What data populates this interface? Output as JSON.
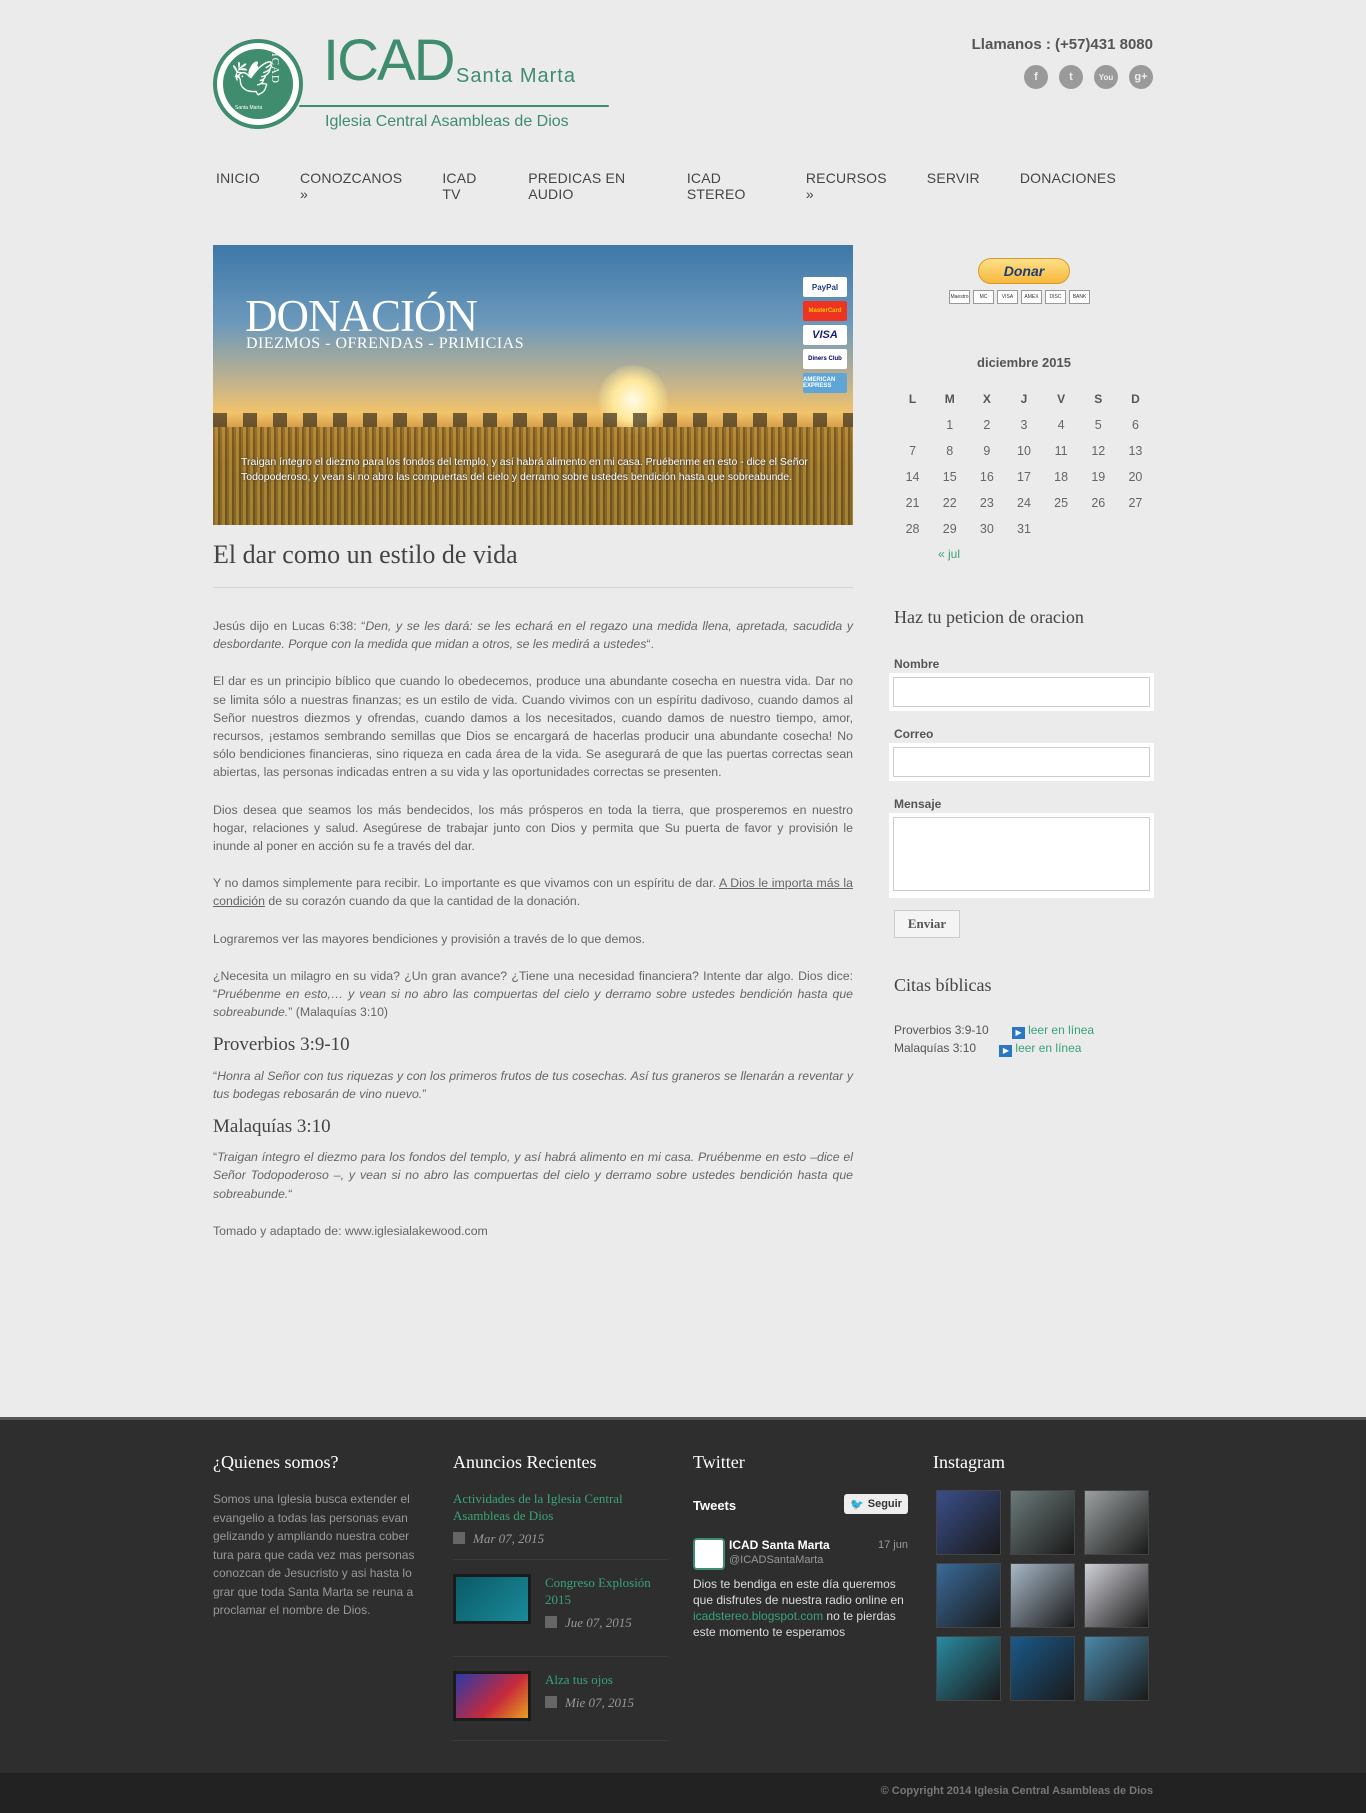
{
  "header": {
    "logo_title": "ICAD",
    "logo_sub": "Santa Marta",
    "logo_tagline": "Iglesia Central Asambleas de Dios",
    "logo_badge_vertical": "ICAD",
    "logo_badge_small": "Santa Marta",
    "phone": "Llamanos : (+57)431 8080",
    "social": [
      "f",
      "t",
      "You",
      "g+"
    ]
  },
  "nav": [
    "INICIO",
    "CONOZCANOS »",
    "ICAD TV",
    "PREDICAS EN AUDIO",
    "ICAD STEREO",
    "RECURSOS »",
    "SERVIR",
    "DONACIONES"
  ],
  "banner": {
    "title": "DONACIÓN",
    "subtitle": "DIEZMOS - OFRENDAS - PRIMICIAS",
    "quote": "Traigan íntegro el diezmo para los fondos del templo, y así habrá alimento en mi casa. Pruébenme en esto - dice el Señor Todopoderoso, y vean si no abro las compuertas del cielo y derramo sobre ustedes bendición hasta que sobreabunde.",
    "cards": [
      "PayPal",
      "MasterCard",
      "VISA",
      "Diners Club",
      "AMERICAN EXPRESS"
    ]
  },
  "post": {
    "title": "El dar como un estilo de vida",
    "p1_a": "Jesús dijo en Lucas 6:38: “",
    "p1_em": "Den, y se les dará: se les echará en el regazo una medida llena, apretada, sacudida y desbordante. Porque con la medida que midan a otros, se les medirá a ustedes",
    "p1_b": "“.",
    "p2": "El dar es un principio bíblico que cuando lo obedecemos, produce una abundante cosecha en nuestra vida. Dar no se limita sólo a nuestras finanzas; es un estilo de vida. Cuando vivimos con un espíritu dadivoso, cuando damos al Señor nuestros diezmos y ofrendas, cuando damos a los necesitados, cuando damos de nuestro tiempo, amor, recursos, ¡estamos sembrando semillas que Dios se encargará de hacerlas producir una abundante cosecha! No sólo bendiciones financieras, sino riqueza en cada área de la vida. Se asegurará de que las puertas correctas sean abiertas, las personas indicadas entren a su vida y las oportunidades correctas se presenten.",
    "p3": "Dios desea que seamos los más bendecidos, los más prósperos en toda la tierra, que prosperemos en nuestro hogar, relaciones y salud. Asegúrese de trabajar junto con Dios y permita que Su puerta de favor y provisión le inunde al poner en acción su fe a través del dar.",
    "p4_a": "Y no damos simplemente para recibir. Lo importante es que vivamos con un espíritu de dar. ",
    "p4_u": "A Dios le importa más la condición",
    "p4_b": " de su corazón cuando da que la cantidad de la donación.",
    "p5": "Lograremos ver las mayores bendiciones y provisión a través de lo que demos.",
    "p6_a": "¿Necesita un milagro en su vida? ¿Un gran avance? ¿Tiene una necesidad financiera? Intente dar algo. Dios dice: “",
    "p6_em": "Pruébenme en esto,… y vean si no abro las compuertas del cielo y derramo sobre ustedes bendición hasta que sobreabunde.",
    "p6_b": "” (Malaquías 3:10)",
    "h2a": "Proverbios 3:9-10",
    "q1_a": "“",
    "q1_em": "Honra al Señor con tus riquezas y con los primeros frutos de tus cosechas. Así tus graneros se llenarán a reventar y tus bodegas rebosarán de vino nuevo.",
    "q1_b": "”",
    "h2b": "Malaquías 3:10",
    "q2_a": "“",
    "q2_em": "Traigan íntegro el diezmo para los fondos del templo, y así habrá alimento en mi casa. Pruébenme en esto –dice el Señor Todopoderoso –, y vean si no abro las compuertas del cielo y derramo sobre ustedes bendición hasta que sobreabunde.",
    "q2_b": "“",
    "source": "Tomado y adaptado de: www.iglesialakewood.com"
  },
  "sidebar": {
    "donate_label": "Donar",
    "donate_minis": [
      "Maestro",
      "MC",
      "VISA",
      "AMEX",
      "DISC",
      "BANK"
    ],
    "calendar": {
      "caption": "diciembre 2015",
      "days": [
        "L",
        "M",
        "X",
        "J",
        "V",
        "S",
        "D"
      ],
      "weeks": [
        [
          "",
          "1",
          "2",
          "3",
          "4",
          "5",
          "6"
        ],
        [
          "7",
          "8",
          "9",
          "10",
          "11",
          "12",
          "13"
        ],
        [
          "14",
          "15",
          "16",
          "17",
          "18",
          "19",
          "20"
        ],
        [
          "21",
          "22",
          "23",
          "24",
          "25",
          "26",
          "27"
        ],
        [
          "28",
          "29",
          "30",
          "31",
          "",
          "",
          ""
        ]
      ],
      "prev": "« jul"
    },
    "prayer_title": "Haz tu peticion de oracion",
    "name_label": "Nombre",
    "email_label": "Correo",
    "message_label": "Mensaje",
    "send_label": "Enviar",
    "citas_title": "Citas bíblicas",
    "citas": [
      {
        "ref": "Proverbios 3:9-10",
        "link": "leer en línea"
      },
      {
        "ref": "Malaquías 3:10",
        "link": "leer en línea"
      }
    ]
  },
  "footer": {
    "about_title": "¿Quienes somos?",
    "about_text": "Somos una Iglesia busca extender el evangelio a todas las personas evan gelizando y ampliando nuestra cober tura para que cada vez mas personas conozcan de Jesucristo y asi hasta lo grar que toda Santa Marta se reuna a proclamar el nombre de Dios.",
    "ann_title": "Anuncios Recientes",
    "announcements": [
      {
        "title": "Actividades de la Iglesia Central Asambleas de Dios",
        "date": "Mar 07, 2015"
      },
      {
        "title": "Congreso Explosión 2015",
        "date": "Jue 07, 2015"
      },
      {
        "title": "Alza tus ojos",
        "date": "Mie 07, 2015"
      }
    ],
    "twitter_title": "Twitter",
    "tweets_label": "Tweets",
    "follow_label": "Seguir",
    "tweet": {
      "name": "ICAD Santa Marta",
      "handle": "@ICADSantaMarta",
      "time": "17 jun",
      "text_a": "Dios te bendiga en este día queremos que disfrutes de nuestra radio online en ",
      "link": "icadstereo.blogspot.com",
      "text_b": " no te pierdas este momento te esperamos"
    },
    "insta_title": "Instagram",
    "insta_colors": [
      "#3a4e8a",
      "#6c7a7a",
      "#9aa0a0",
      "#3a6a9a",
      "#a8b8c8",
      "#d0d0d8",
      "#2a8aa0",
      "#1a5a8a",
      "#4a88a8"
    ],
    "copyright": "© Copyright 2014 Iglesia Central Asambleas de Dios"
  }
}
